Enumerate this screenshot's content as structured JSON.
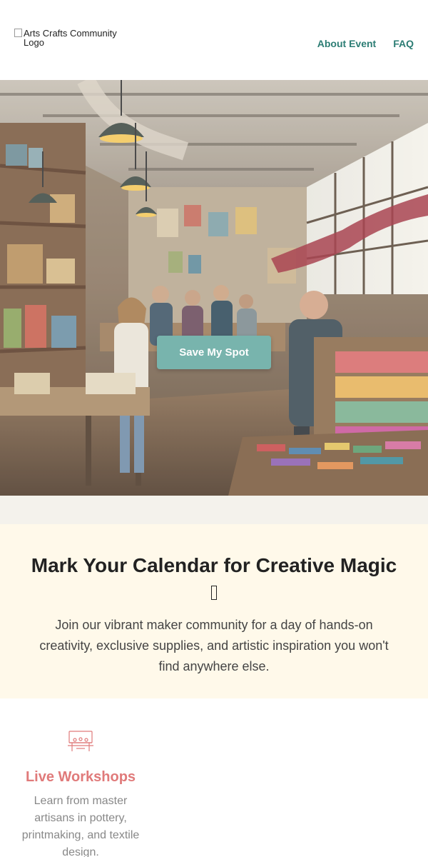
{
  "header": {
    "logo_alt": "Arts Crafts Community Logo",
    "nav": [
      {
        "label": "About Event"
      },
      {
        "label": "FAQ"
      }
    ]
  },
  "hero": {
    "cta_label": "Save My Spot"
  },
  "calendar": {
    "title": "Mark Your Calendar for Creative Magic",
    "description": "Join our vibrant maker community for a day of hands-on creativity, exclusive supplies, and artistic inspiration you won't find anywhere else."
  },
  "features": [
    {
      "icon": "workshop-table-icon",
      "title": "Live Workshops",
      "description": "Learn from master artisans in pottery, printmaking, and textile design."
    }
  ],
  "colors": {
    "accent_teal": "#2c7d74",
    "cta_bg": "#78b4ad",
    "feature_title": "#e07a7a",
    "calendar_bg": "#fff9ea"
  }
}
